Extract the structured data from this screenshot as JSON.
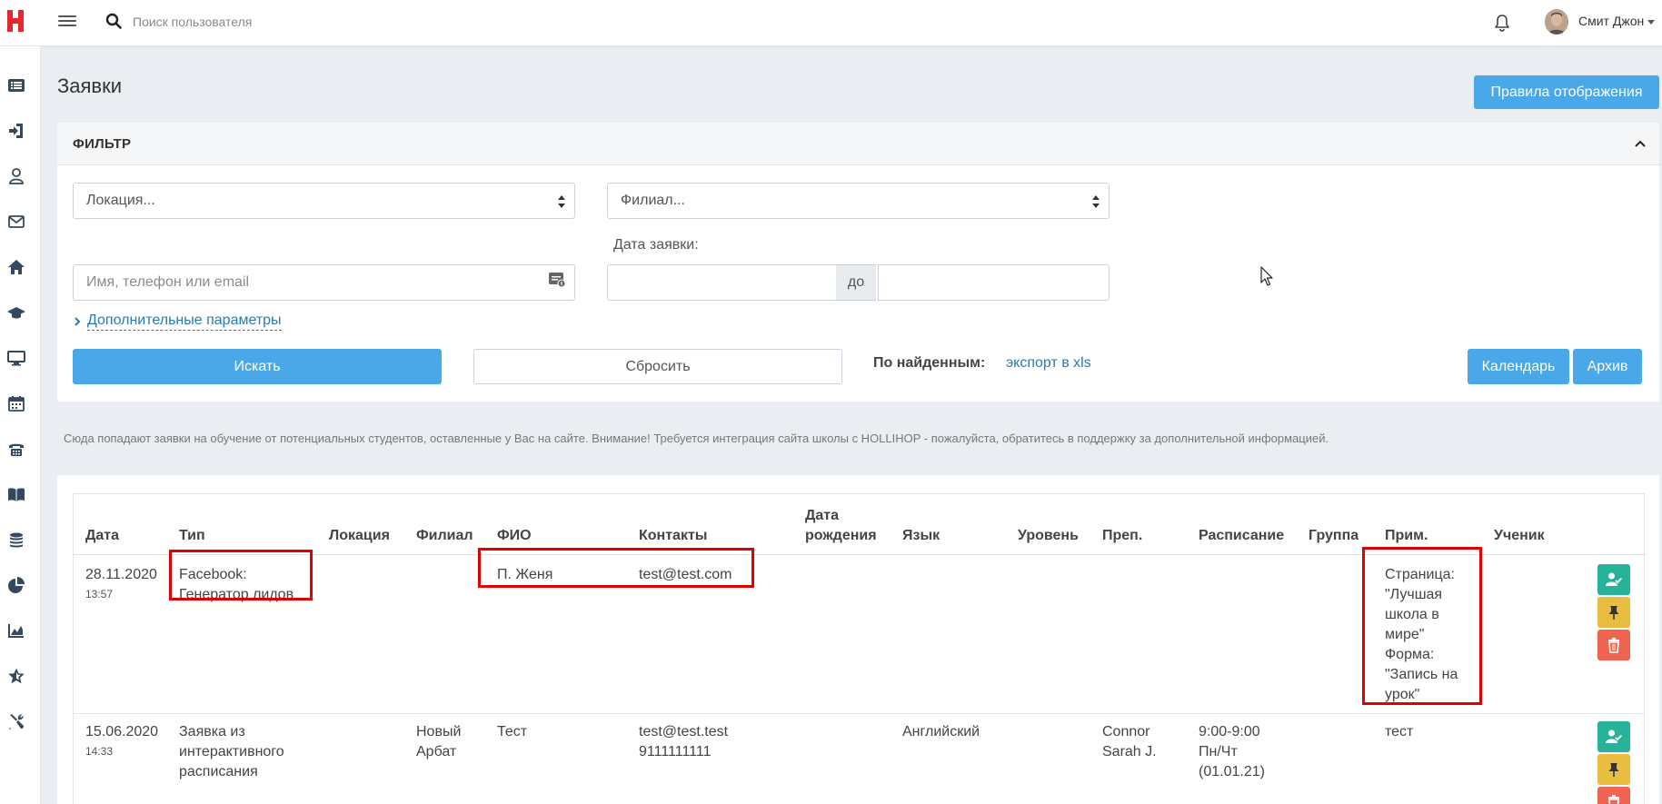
{
  "topbar": {
    "search_placeholder": "Поиск пользователя",
    "username": "Смит Джон"
  },
  "sidebar": {
    "items": [
      "list-icon",
      "sign-in-icon",
      "user-icon",
      "envelope-icon",
      "home-icon",
      "graduation-cap-icon",
      "desktop-icon",
      "calendar-icon",
      "phone-icon",
      "book-icon",
      "coins-icon",
      "pie-chart-icon",
      "area-chart-icon",
      "star-icon",
      "tools-icon"
    ]
  },
  "page": {
    "title": "Заявки",
    "display_rules_label": "Правила отображения"
  },
  "filter": {
    "title": "ФИЛЬТР",
    "location_value": "Локация...",
    "branch_value": "Филиал...",
    "date_label": "Дата заявки:",
    "name_placeholder": "Имя, телефон или email",
    "date_to_label": "до",
    "advanced_label": "Дополнительные параметры",
    "search_label": "Искать",
    "reset_label": "Сбросить",
    "found_label": "По найденным:",
    "export_label": "экспорт в xls",
    "calendar_label": "Календарь",
    "archive_label": "Архив"
  },
  "info_text": "Сюда попадают заявки на обучение от потенциальных студентов, оставленные у Вас на сайте. Внимание! Требуется интеграция сайта школы с HOLLIHOP - пожалуйста, обратитесь в поддержку за дополнительной информацией.",
  "table": {
    "headers": {
      "date": "Дата",
      "type": "Тип",
      "location": "Локация",
      "branch": "Филиал",
      "fio": "ФИО",
      "contacts": "Контакты",
      "birth1": "Дата",
      "birth2": "рождения",
      "language": "Язык",
      "level": "Уровень",
      "teacher": "Преп.",
      "schedule": "Расписание",
      "group": "Группа",
      "note": "Прим.",
      "student": "Ученик"
    },
    "rows": [
      {
        "date": "28.11.2020",
        "time": "13:57",
        "type_1": "Facebook:",
        "type_2": "Генератор лидов",
        "fio": "П. Женя",
        "contacts_1": "test@test.com",
        "note_1": "Страница:",
        "note_2": "\"Лучшая",
        "note_3": "школа в",
        "note_4": "мире\"",
        "note_5": "Форма:",
        "note_6": "\"Запись на",
        "note_7": "урок\""
      },
      {
        "date": "15.06.2020",
        "time": "14:33",
        "type_1": "Заявка из",
        "type_2": "интерактивного",
        "type_3": "расписания",
        "branch_1": "Новый",
        "branch_2": "Арбат",
        "fio": "Тест",
        "contacts_1": "test@test.test",
        "contacts_2": "9111111111",
        "language": "Английский",
        "teacher_1": "Connor",
        "teacher_2": "Sarah J.",
        "schedule_1": "9:00-9:00",
        "schedule_2": "Пн/Чт",
        "schedule_3": "(01.01.21)",
        "note_1": "тест"
      }
    ]
  },
  "colors": {
    "primary": "#4aa8e8",
    "link": "#2b79b5",
    "highlight": "#e00000",
    "btn_green": "#26b39a",
    "btn_yellow": "#e9bd3f",
    "btn_red": "#f06452",
    "logo": "#e8262c"
  }
}
